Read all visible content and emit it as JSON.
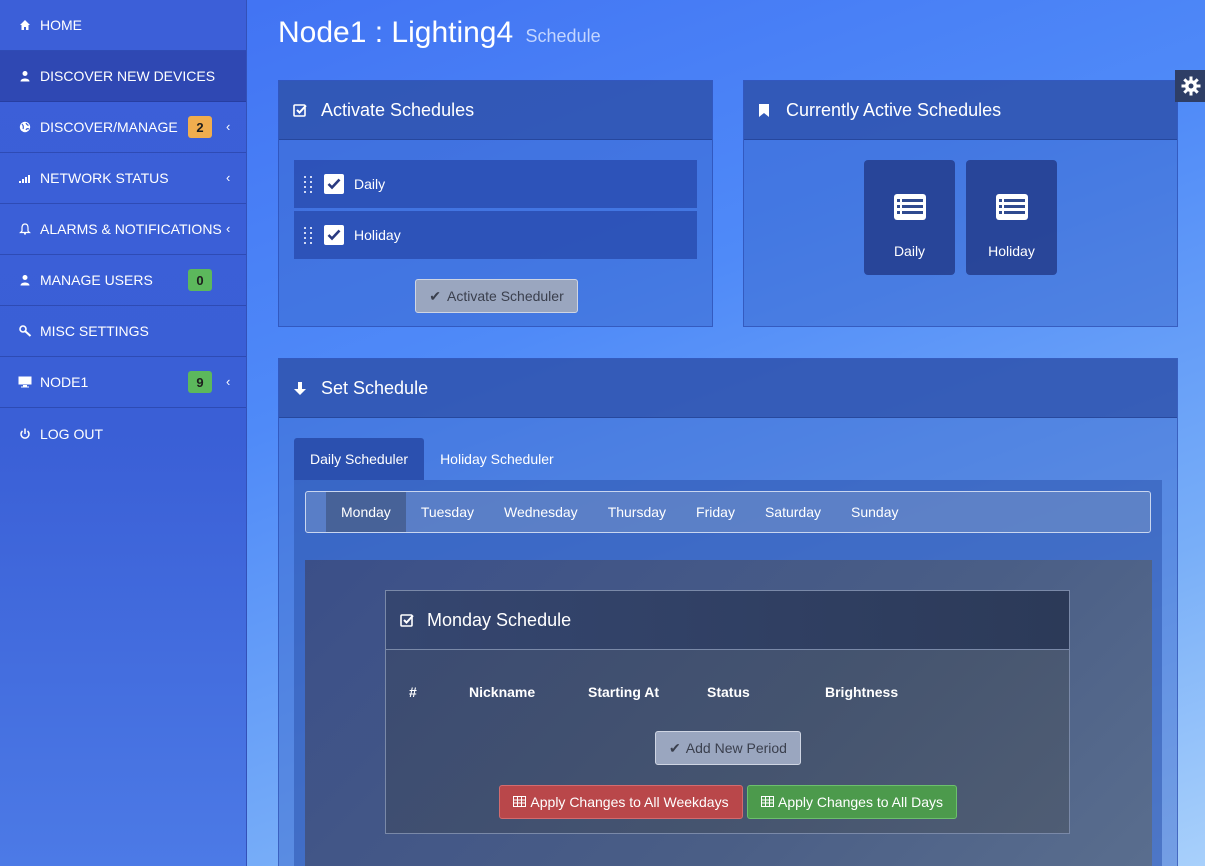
{
  "sidebar": {
    "items": [
      {
        "label": "HOME",
        "icon": "home-icon"
      },
      {
        "label": "DISCOVER NEW DEVICES",
        "icon": "user-icon"
      },
      {
        "label": "DISCOVER/MANAGE",
        "icon": "globe-icon",
        "badge": "2"
      },
      {
        "label": "NETWORK STATUS",
        "icon": "signal-icon"
      },
      {
        "label": "ALARMS & NOTIFICATIONS",
        "icon": "bell-icon"
      },
      {
        "label": "MANAGE USERS",
        "icon": "user-icon",
        "badge": "0"
      },
      {
        "label": "MISC SETTINGS",
        "icon": "wrench-icon"
      },
      {
        "label": "NODE1",
        "icon": "monitor-icon",
        "badge": "9"
      },
      {
        "label": "LOG OUT",
        "icon": "power-icon"
      }
    ]
  },
  "page": {
    "title": "Node1 : Lighting4",
    "subtitle": "Schedule"
  },
  "activate_panel": {
    "title": "Activate Schedules",
    "items": [
      "Daily",
      "Holiday"
    ],
    "button": "Activate Scheduler"
  },
  "active_panel": {
    "title": "Currently Active Schedules",
    "tiles": [
      "Daily",
      "Holiday"
    ]
  },
  "set_panel": {
    "title": "Set Schedule",
    "tabs": [
      "Daily Scheduler",
      "Holiday Scheduler"
    ],
    "days": [
      "Monday",
      "Tuesday",
      "Wednesday",
      "Thursday",
      "Friday",
      "Saturday",
      "Sunday"
    ],
    "monday": {
      "title": "Monday Schedule",
      "columns": [
        "#",
        "Nickname",
        "Starting At",
        "Status",
        "Brightness"
      ],
      "add_button": "Add New Period",
      "apply_weekdays": "Apply Changes to All Weekdays",
      "apply_all": "Apply Changes to All Days"
    }
  },
  "colors": {
    "badge_orange": "#f0ad4e",
    "badge_green": "#5cb85c",
    "danger": "#b9474a",
    "success": "#4c9a4c"
  }
}
